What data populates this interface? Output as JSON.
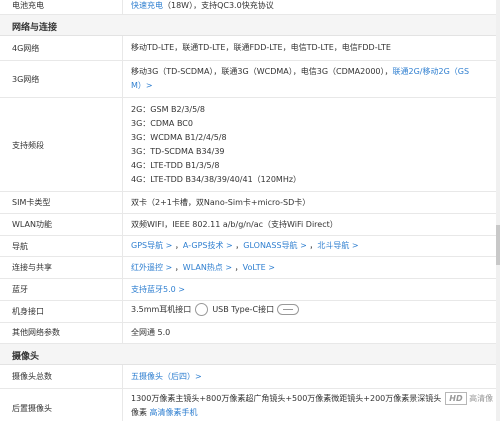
{
  "battery": {
    "key": "电池充电",
    "fast_link": "快速充电",
    "rest": "（18W），支持QC3.0快充协议"
  },
  "network_section": "网络与连接",
  "net4g": {
    "key": "4G网络",
    "value": "移动TD-LTE，联通TD-LTE，联通FDD-LTE，电信TD-LTE，电信FDD-LTE"
  },
  "net3g": {
    "key": "3G网络",
    "line1": "移动3G（TD-SCDMA），联通3G（WCDMA），电信3G（CDMA2000），",
    "link1": "联通2G/移动2G（GS",
    "link2": "M）>"
  },
  "bands": {
    "key": "支持频段",
    "lines": [
      "2G：GSM B2/3/5/8",
      "3G：CDMA BC0",
      "3G：WCDMA B1/2/4/5/8",
      "3G：TD-SCDMA B34/39",
      "4G：LTE-TDD B1/3/5/8",
      "4G：LTE-TDD B34/38/39/40/41（120MHz）"
    ]
  },
  "sim": {
    "key": "SIM卡类型",
    "value": "双卡（2+1卡槽，双Nano-Sim卡+micro-SD卡）"
  },
  "wlan": {
    "key": "WLAN功能",
    "value": "双频WIFI，IEEE 802.11 a/b/g/n/ac（支持WiFi Direct）"
  },
  "nav": {
    "key": "导航",
    "links": [
      "GPS导航",
      "A-GPS技术",
      "GLONASS导航",
      "北斗导航"
    ],
    "separator": "，"
  },
  "connect": {
    "key": "连接与共享",
    "links": [
      "红外遥控",
      "WLAN热点",
      "VoLTE"
    ],
    "separator": "，"
  },
  "bluetooth": {
    "key": "蓝牙",
    "link": "支持蓝牙5.0"
  },
  "ports": {
    "key": "机身接口",
    "jack": "3.5mm耳机接口",
    "usb": "USB Type-C接口"
  },
  "other_net": {
    "key": "其他网络参数",
    "value": "全网通 5.0"
  },
  "camera_section": "摄像头",
  "cam_total": {
    "key": "摄像头总数",
    "link": "五摄像头（后四）>"
  },
  "rear_cam": {
    "key": "后置摄像头",
    "line1": "1300万像素主镜头+800万像素超广角镜头+500万像素微距镜头+200万像素景深镜头",
    "hd_badge": "HD",
    "hd_label": "高清像",
    "line2_prefix": "像素",
    "line2_link": "高清像素手机"
  },
  "colors": {
    "link": "#2f7fd0",
    "section_bg": "#f5f5f5",
    "border": "#e8e8e8"
  }
}
